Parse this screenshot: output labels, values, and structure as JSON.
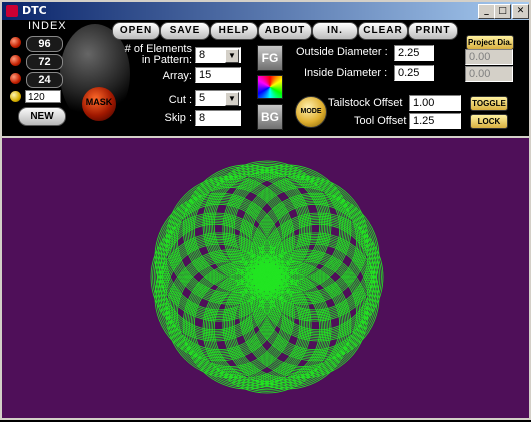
{
  "window": {
    "title": "DTC",
    "minimize": "_",
    "maximize": "□",
    "close": "✕"
  },
  "menu": [
    "OPEN",
    "SAVE",
    "HELP",
    "ABOUT",
    "IN.",
    "CLEAR",
    "PRINT"
  ],
  "index": {
    "title": "INDEX",
    "presets": [
      "96",
      "72",
      "24"
    ],
    "custom": "120",
    "new_label": "NEW",
    "mask_label": "MASK"
  },
  "pattern": {
    "elements_label_1": "# of Elements",
    "elements_label_2": "in Pattern:",
    "elements_value": "8",
    "array_label": "Array:",
    "array_value": "15",
    "cut_label": "Cut :",
    "cut_value": "5",
    "skip_label": "Skip :",
    "skip_value": "8"
  },
  "color_buttons": {
    "fg": "FG",
    "bg": "BG"
  },
  "diameter": {
    "outside_label": "Outside Diameter :",
    "outside_value": "2.25",
    "inside_label": "Inside Diameter :",
    "inside_value": "0.25"
  },
  "project": {
    "label": "Project Dia.",
    "value1": "0.00",
    "value2": "0.00"
  },
  "offsets": {
    "mode_label": "MODE",
    "tailstock_label": "Tailstock Offset",
    "tailstock_value": "1.00",
    "tool_label": "Tool Offset",
    "tool_value": "1.25",
    "toggle_label": "TOGGLE",
    "lock_label": "LOCK"
  },
  "colors": {
    "canvas_bg": "#4f0f59",
    "pattern_stroke": "#22e522",
    "accent_led": "#c21f00"
  },
  "spirograph": {
    "petals": 16,
    "rings": 8
  }
}
